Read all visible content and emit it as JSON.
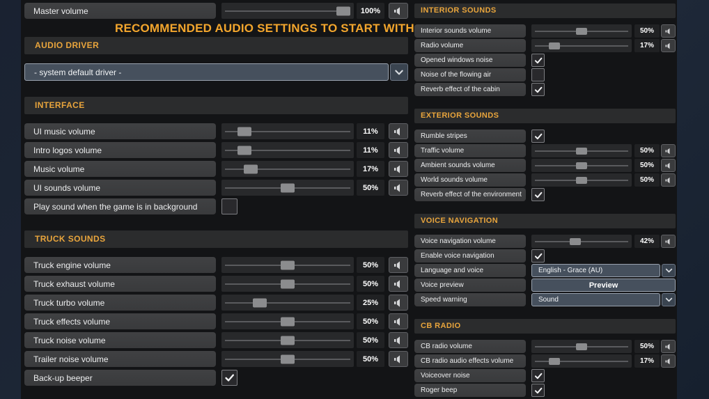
{
  "colors": {
    "accent_orange": "#e9a53c",
    "banner_orange": "#f3a62d",
    "panel_bg": "#131416",
    "backdrop_navy": "#1e2838",
    "dropdown_blue": "#46505d"
  },
  "banner": "RECOMMENDED AUDIO SETTINGS TO START WITH",
  "master_row": {
    "type": "slider",
    "label": "Master volume",
    "value": "100%",
    "percent": 100
  },
  "left_sections": [
    {
      "title": "AUDIO DRIVER",
      "rows": [
        {
          "type": "dropdown",
          "value": "- system default driver -"
        }
      ]
    },
    {
      "title": "INTERFACE",
      "rows": [
        {
          "type": "slider",
          "label": "UI music volume",
          "value": "11%",
          "percent": 11
        },
        {
          "type": "slider",
          "label": "Intro logos volume",
          "value": "11%",
          "percent": 11
        },
        {
          "type": "slider",
          "label": "Music volume",
          "value": "17%",
          "percent": 17
        },
        {
          "type": "slider",
          "label": "UI sounds volume",
          "value": "50%",
          "percent": 50
        },
        {
          "type": "checkbox",
          "label": "Play sound when the game is in background",
          "checked": false
        }
      ]
    },
    {
      "title": "TRUCK SOUNDS",
      "rows": [
        {
          "type": "slider",
          "label": "Truck engine volume",
          "value": "50%",
          "percent": 50
        },
        {
          "type": "slider",
          "label": "Truck exhaust volume",
          "value": "50%",
          "percent": 50
        },
        {
          "type": "slider",
          "label": "Truck turbo volume",
          "value": "25%",
          "percent": 25
        },
        {
          "type": "slider",
          "label": "Truck effects volume",
          "value": "50%",
          "percent": 50
        },
        {
          "type": "slider",
          "label": "Truck noise volume",
          "value": "50%",
          "percent": 50
        },
        {
          "type": "slider",
          "label": "Trailer noise volume",
          "value": "50%",
          "percent": 50
        },
        {
          "type": "checkbox",
          "label": "Back-up beeper",
          "checked": true
        }
      ]
    }
  ],
  "right_sections": [
    {
      "title": "INTERIOR SOUNDS",
      "rows": [
        {
          "type": "slider",
          "label": "Interior sounds volume",
          "value": "50%",
          "percent": 50
        },
        {
          "type": "slider",
          "label": "Radio volume",
          "value": "17%",
          "percent": 17
        },
        {
          "type": "checkbox",
          "label": "Opened windows noise",
          "checked": true
        },
        {
          "type": "checkbox",
          "label": "Noise of the flowing air",
          "checked": false
        },
        {
          "type": "checkbox",
          "label": "Reverb effect of the cabin",
          "checked": true
        }
      ]
    },
    {
      "title": "EXTERIOR SOUNDS",
      "rows": [
        {
          "type": "checkbox",
          "label": "Rumble stripes",
          "checked": true
        },
        {
          "type": "slider",
          "label": "Traffic volume",
          "value": "50%",
          "percent": 50
        },
        {
          "type": "slider",
          "label": "Ambient sounds volume",
          "value": "50%",
          "percent": 50
        },
        {
          "type": "slider",
          "label": "World sounds volume",
          "value": "50%",
          "percent": 50
        },
        {
          "type": "checkbox",
          "label": "Reverb effect of the environment",
          "checked": true
        }
      ]
    },
    {
      "title": "VOICE NAVIGATION",
      "rows": [
        {
          "type": "slider",
          "label": "Voice navigation volume",
          "value": "42%",
          "percent": 42
        },
        {
          "type": "checkbox",
          "label": "Enable voice navigation",
          "checked": true
        },
        {
          "type": "dropdown",
          "label": "Language and voice",
          "value": "English - Grace (AU)"
        },
        {
          "type": "button",
          "label": "Voice preview",
          "value": "Preview"
        },
        {
          "type": "dropdown",
          "label": "Speed warning",
          "value": "Sound"
        }
      ]
    },
    {
      "title": "CB RADIO",
      "rows": [
        {
          "type": "slider",
          "label": "CB radio volume",
          "value": "50%",
          "percent": 50
        },
        {
          "type": "slider",
          "label": "CB radio audio effects volume",
          "value": "17%",
          "percent": 17
        },
        {
          "type": "checkbox",
          "label": "Voiceover noise",
          "checked": true
        },
        {
          "type": "checkbox",
          "label": "Roger beep",
          "checked": true
        }
      ]
    }
  ]
}
